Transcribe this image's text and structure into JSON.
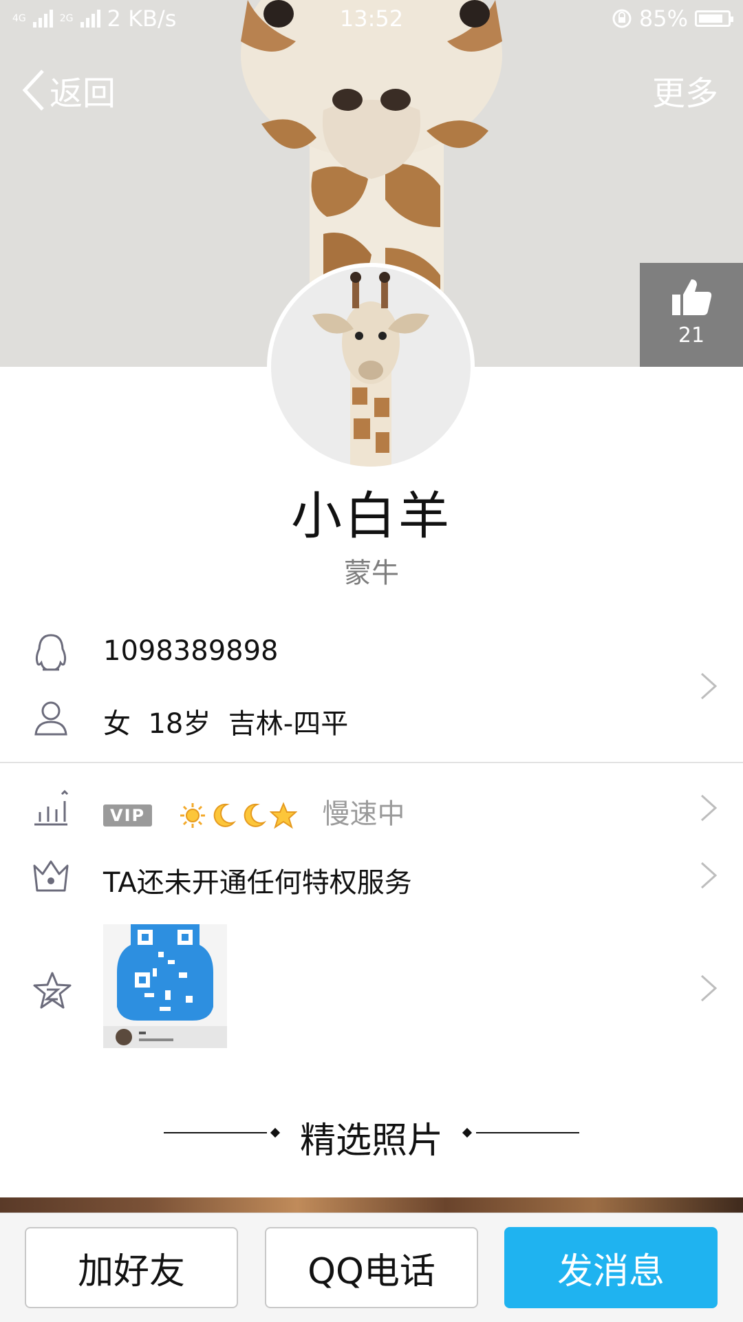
{
  "status_bar": {
    "network_left": "4G",
    "network_small": "2G",
    "speed": "2 KB/s",
    "time": "13:52",
    "battery": "85%",
    "battery_level": 0.85
  },
  "nav": {
    "back_label": "返回",
    "more_label": "更多"
  },
  "like": {
    "count": "21"
  },
  "profile": {
    "nickname": "小白羊",
    "subname": "蒙牛"
  },
  "info": {
    "qq_number": "1098389898",
    "gender": "女",
    "age": "18岁",
    "location": "吉林-四平"
  },
  "level": {
    "vip_label": "VIP",
    "status": "慢速中"
  },
  "privilege": {
    "text": "TA还未开通任何特权服务"
  },
  "qzone": {},
  "section": {
    "title": "精选照片"
  },
  "actions": {
    "add_friend": "加好友",
    "qq_call": "QQ电话",
    "send_message": "发消息"
  },
  "colors": {
    "primary": "#1fb3f0",
    "icon_gray": "#6b6b7b"
  }
}
